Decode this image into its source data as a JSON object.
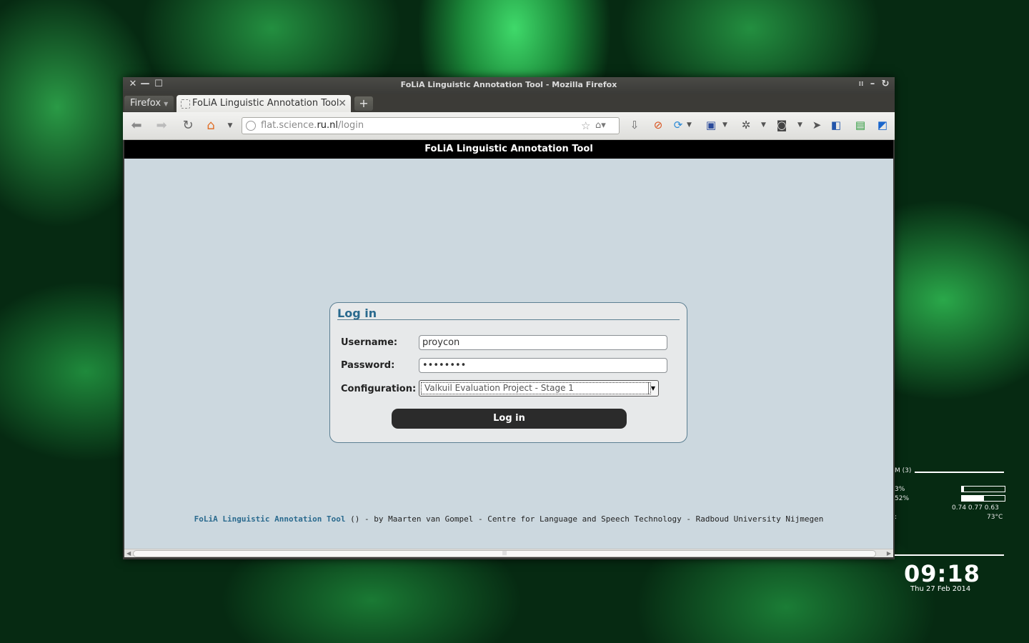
{
  "window": {
    "title": "FoLiA Linguistic Annotation Tool - Mozilla Firefox",
    "firefox_menu": "Firefox"
  },
  "tabs": [
    {
      "label": "FoLiA Linguistic Annotation Tool",
      "active": true
    }
  ],
  "urlbar": {
    "url_prefix": "flat.science.",
    "url_host": "ru.nl",
    "url_path": "/login"
  },
  "page": {
    "header_title": "FoLiA Linguistic Annotation Tool",
    "login": {
      "title": "Log in",
      "username_label": "Username:",
      "username_value": "proycon",
      "password_label": "Password:",
      "password_value": "••••••••",
      "configuration_label": "Configuration:",
      "configuration_value": "Valkuil Evaluation Project - Stage 1",
      "button_label": "Log in"
    },
    "footer": {
      "link_text": "FoLiA Linguistic Annotation Tool",
      "rest_text": " () - by Maarten van Gompel - Centre for Language and Speech Technology - Radboud University Nijmegen"
    }
  },
  "conky": {
    "header": "M (3)",
    "cpu1": "3%",
    "cpu2": "52%",
    "cpu1_fill": 0.05,
    "cpu2_fill": 0.52,
    "loadavg": "0.74 0.77 0.63",
    "temp": "73°C",
    "colon": ":",
    "time": "09:18",
    "date": "Thu 27 Feb 2014"
  },
  "colors": {
    "accent": "#2a6a8e",
    "page_bg": "#ccd8df",
    "header_bg": "#000000",
    "button_bg": "#2b2b2b"
  }
}
